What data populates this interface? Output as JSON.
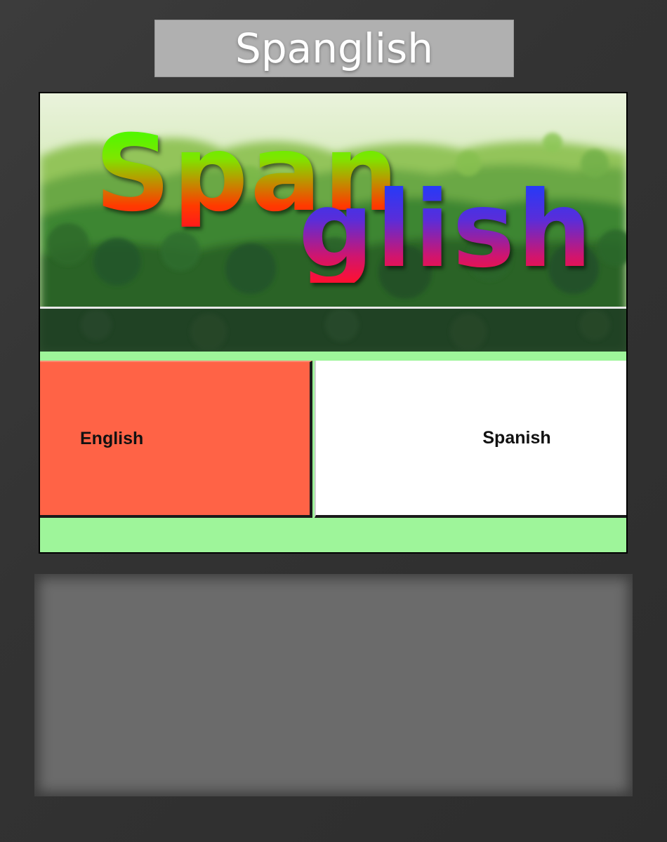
{
  "header": {
    "title": "Spanglish"
  },
  "banner": {
    "logo_line1": "Span",
    "logo_line2": "glish",
    "colors": {
      "line1_top": "#3dff00",
      "line1_bottom": "#ff1a1a",
      "line2_top": "#1a3dff",
      "line2_bottom": "#ff1030"
    }
  },
  "languages": {
    "english_label": "English",
    "spanish_label": "Spanish",
    "english_color": "#ff6346",
    "spanish_color": "#ffffff"
  },
  "theme": {
    "accent_green": "#9ef59a",
    "background": "#333333",
    "panel": "#6b6b6b"
  }
}
